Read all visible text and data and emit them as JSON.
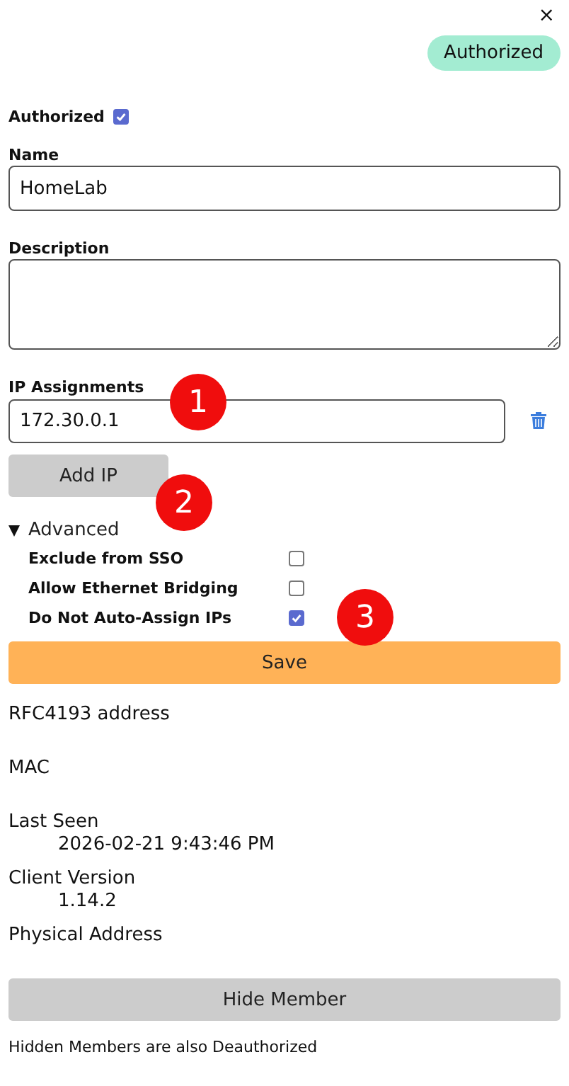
{
  "close": "×",
  "status_badge": "Authorized",
  "authorized": {
    "label": "Authorized",
    "checked": true
  },
  "name_field": {
    "label": "Name",
    "value": "HomeLab"
  },
  "description_field": {
    "label": "Description"
  },
  "ip_assignments": {
    "label": "IP Assignments",
    "ips": [
      "172.30.0.1"
    ],
    "add_button": "Add IP"
  },
  "advanced": {
    "label": "Advanced",
    "expanded": true,
    "options": [
      {
        "label": "Exclude from SSO",
        "checked": false
      },
      {
        "label": "Allow Ethernet Bridging",
        "checked": false
      },
      {
        "label": "Do Not Auto-Assign IPs",
        "checked": true
      }
    ]
  },
  "save_button": "Save",
  "info": [
    {
      "label": "RFC4193 address"
    },
    {
      "label": "MAC"
    },
    {
      "label": "Last Seen",
      "value": "2026-02-21 9:43:46 PM"
    },
    {
      "label": "Client Version",
      "value": "1.14.2"
    },
    {
      "label": "Physical Address"
    }
  ],
  "hide_button": "Hide Member",
  "footnote": "Hidden Members are also Deauthorized",
  "annotations": [
    "1",
    "2",
    "3"
  ]
}
